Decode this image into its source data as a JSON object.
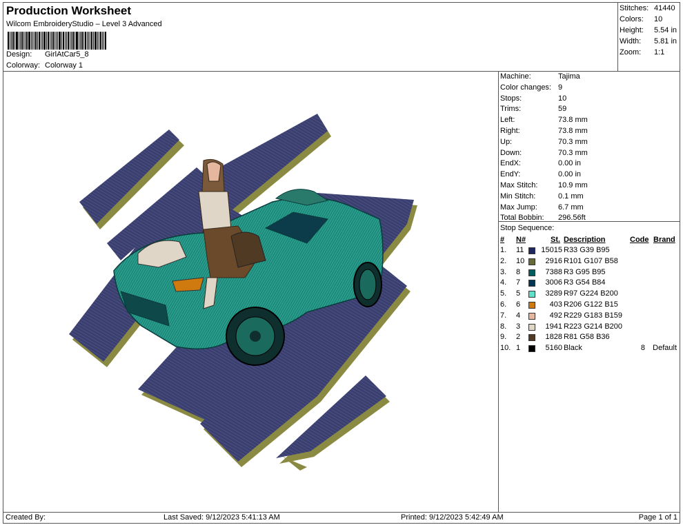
{
  "header": {
    "title": "Production Worksheet",
    "subtitle": "Wilcom EmbroideryStudio – Level 3 Advanced",
    "design_label": "Design:",
    "design_value": "GirlAtCar5_8",
    "colorway_label": "Colorway:",
    "colorway_value": "Colorway 1"
  },
  "stats": [
    {
      "label": "Stitches:",
      "value": "41440"
    },
    {
      "label": "Colors:",
      "value": "10"
    },
    {
      "label": "Height:",
      "value": "5.54 in"
    },
    {
      "label": "Width:",
      "value": "5.81 in"
    },
    {
      "label": "Zoom:",
      "value": "1:1"
    }
  ],
  "machine_info": [
    {
      "label": "Machine:",
      "value": "Tajima"
    },
    {
      "label": "Color changes:",
      "value": "9"
    },
    {
      "label": "Stops:",
      "value": "10"
    },
    {
      "label": "Trims:",
      "value": "59"
    },
    {
      "label": "Left:",
      "value": "73.8 mm"
    },
    {
      "label": "Right:",
      "value": "73.8 mm"
    },
    {
      "label": "Up:",
      "value": "70.3 mm"
    },
    {
      "label": "Down:",
      "value": "70.3 mm"
    },
    {
      "label": "EndX:",
      "value": "0.00 in"
    },
    {
      "label": "EndY:",
      "value": "0.00 in"
    },
    {
      "label": "Max Stitch:",
      "value": "10.9 mm"
    },
    {
      "label": "Min Stitch:",
      "value": "0.1 mm"
    },
    {
      "label": "Max Jump:",
      "value": "6.7 mm"
    },
    {
      "label": "Total Bobbin:",
      "value": "296.56ft"
    }
  ],
  "stop_sequence": {
    "title": "Stop Sequence:",
    "headers": {
      "num": "#",
      "n": "N#",
      "st": "St.",
      "desc": "Description",
      "code": "Code",
      "brand": "Brand"
    },
    "rows": [
      {
        "num": "1.",
        "n": "11",
        "color": "#21275F",
        "st": "15015",
        "desc": "R33 G39 B95",
        "code": "",
        "brand": ""
      },
      {
        "num": "2.",
        "n": "10",
        "color": "#656B3A",
        "st": "2916",
        "desc": "R101 G107 B58",
        "code": "",
        "brand": ""
      },
      {
        "num": "3.",
        "n": "8",
        "color": "#035F5F",
        "st": "7388",
        "desc": "R3 G95 B95",
        "code": "",
        "brand": ""
      },
      {
        "num": "4.",
        "n": "7",
        "color": "#033654",
        "st": "3006",
        "desc": "R3 G54 B84",
        "code": "",
        "brand": ""
      },
      {
        "num": "5.",
        "n": "5",
        "color": "#61E0C8",
        "st": "3289",
        "desc": "R97 G224 B200",
        "code": "",
        "brand": ""
      },
      {
        "num": "6.",
        "n": "6",
        "color": "#CE7A0F",
        "st": "403",
        "desc": "R206 G122 B15",
        "code": "",
        "brand": ""
      },
      {
        "num": "7.",
        "n": "4",
        "color": "#E5B79F",
        "st": "492",
        "desc": "R229 G183 B159",
        "code": "",
        "brand": ""
      },
      {
        "num": "8.",
        "n": "3",
        "color": "#DFD6C8",
        "st": "1941",
        "desc": "R223 G214 B200",
        "code": "",
        "brand": ""
      },
      {
        "num": "9.",
        "n": "2",
        "color": "#513A24",
        "st": "1828",
        "desc": "R81 G58 B36",
        "code": "",
        "brand": ""
      },
      {
        "num": "10.",
        "n": "1",
        "color": "#000000",
        "st": "5160",
        "desc": "Black",
        "code": "8",
        "brand": "Default"
      }
    ]
  },
  "footer": {
    "created_by": "Created By:",
    "last_saved": "Last Saved: 9/12/2023 5:41:13 AM",
    "printed": "Printed: 9/12/2023 5:42:49 AM",
    "page": "Page 1 of 1"
  }
}
